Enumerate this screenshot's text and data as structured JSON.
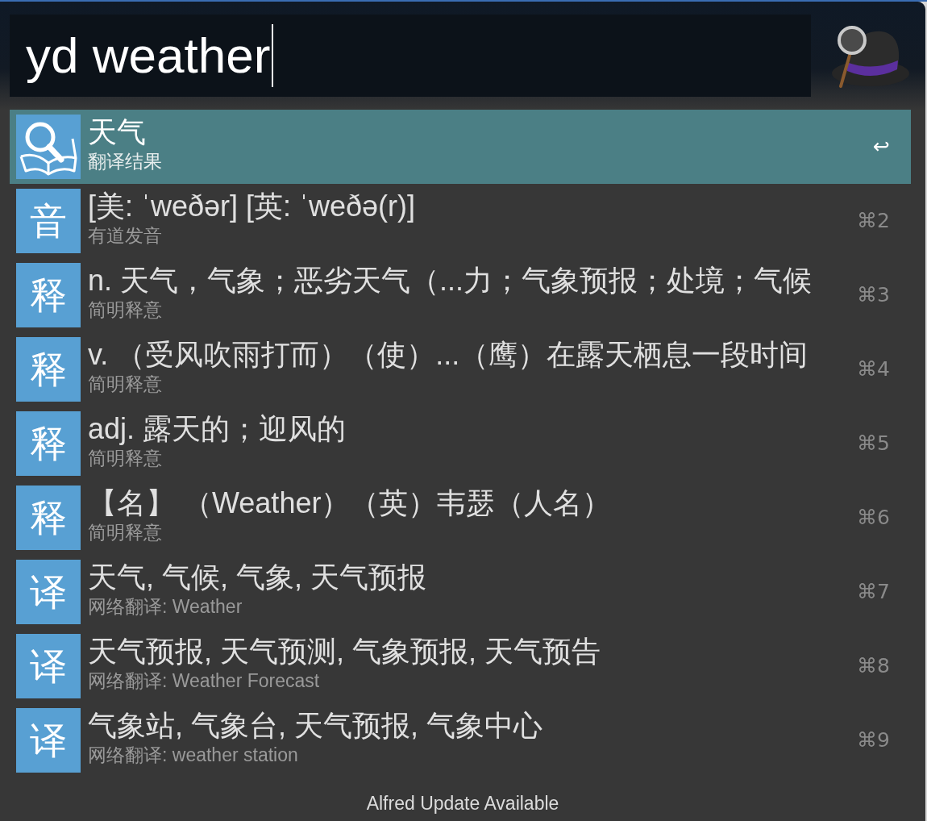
{
  "search": {
    "value": "yd weather",
    "focused": true
  },
  "results": [
    {
      "kind": "lookup",
      "title": "天气",
      "subtitle": "翻译结果",
      "shortcut": "↩",
      "selected": true
    },
    {
      "kind": "glyph",
      "badge": "音",
      "title": "[美: ˈweðər] [英: ˈweðə(r)]",
      "subtitle": "有道发音",
      "shortcut": "⌘2",
      "selected": false
    },
    {
      "kind": "glyph",
      "badge": "释",
      "title": "n. 天气，气象；恶劣天气（...力；气象预报；处境；气候",
      "subtitle": "简明释意",
      "shortcut": "⌘3",
      "selected": false
    },
    {
      "kind": "glyph",
      "badge": "释",
      "title": "v. （受风吹雨打而）（使）...（鹰）在露天栖息一段时间",
      "subtitle": "简明释意",
      "shortcut": "⌘4",
      "selected": false
    },
    {
      "kind": "glyph",
      "badge": "释",
      "title": "adj. 露天的；迎风的",
      "subtitle": "简明释意",
      "shortcut": "⌘5",
      "selected": false
    },
    {
      "kind": "glyph",
      "badge": "释",
      "title": "【名】 （Weather）（英）韦瑟（人名）",
      "subtitle": "简明释意",
      "shortcut": "⌘6",
      "selected": false
    },
    {
      "kind": "glyph",
      "badge": "译",
      "title": "天气, 气候, 气象, 天气预报",
      "subtitle": "网络翻译: Weather",
      "shortcut": "⌘7",
      "selected": false
    },
    {
      "kind": "glyph",
      "badge": "译",
      "title": "天气预报, 天气预测, 气象预报, 天气预告",
      "subtitle": "网络翻译: Weather Forecast",
      "shortcut": "⌘8",
      "selected": false
    },
    {
      "kind": "glyph",
      "badge": "译",
      "title": "气象站, 气象台, 天气预报, 气象中心",
      "subtitle": "网络翻译: weather station",
      "shortcut": "⌘9",
      "selected": false
    }
  ],
  "footer": "Alfred Update Available"
}
